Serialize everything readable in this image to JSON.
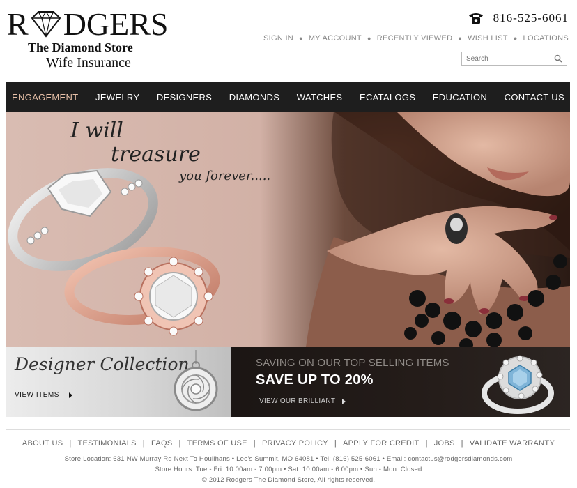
{
  "header": {
    "logo_before": "R",
    "logo_after": "DGERS",
    "logo_subtitle": "The Diamond Store",
    "logo_tagline": "Wife Insurance",
    "phone": "816-525-6061",
    "top_links": [
      "SIGN IN",
      "MY ACCOUNT",
      "RECENTLY VIEWED",
      "WISH LIST",
      "LOCATIONS"
    ],
    "search_placeholder": "Search"
  },
  "nav": {
    "items": [
      "ENGAGEMENT",
      "JEWELRY",
      "DESIGNERS",
      "DIAMONDS",
      "WATCHES",
      "ECATALOGS",
      "EDUCATION",
      "CONTACT US"
    ],
    "active": "ENGAGEMENT",
    "active_color": "#e7c0a8"
  },
  "hero": {
    "line1": "I will",
    "line2": "treasure",
    "line3": "you forever....."
  },
  "promo": {
    "designer_title": "Designer Collection",
    "view_items": "VIEW ITEMS",
    "saving_heading": "SAVING ON OUR TOP SELLING ITEMS",
    "save_text": "SAVE UP TO 20%",
    "view_brilliant": "VIEW OUR BRILLIANT"
  },
  "footer": {
    "links": [
      "ABOUT US",
      "TESTIMONIALS",
      "FAQS",
      "TERMS OF USE",
      "PRIVACY POLICY",
      "APPLY FOR CREDIT",
      "JOBS",
      "VALIDATE WARRANTY"
    ],
    "location": "Store Location: 631 NW Murray Rd Next To Houlihans • Lee's Summit,  MO  64081 • Tel: (816) 525-6061 • Email: contactus@rodgersdiamonds.com",
    "hours": "Store Hours: Tue - Fri: 10:00am - 7:00pm • Sat: 10:00am - 6:00pm • Sun - Mon: Closed",
    "copyright": "© 2012 Rodgers The Diamond Store, All rights reserved."
  },
  "colors": {
    "nav_bg": "#1e1e1e",
    "hero_bg": "#d5b5ab",
    "promo_dark": "#1b1614"
  }
}
